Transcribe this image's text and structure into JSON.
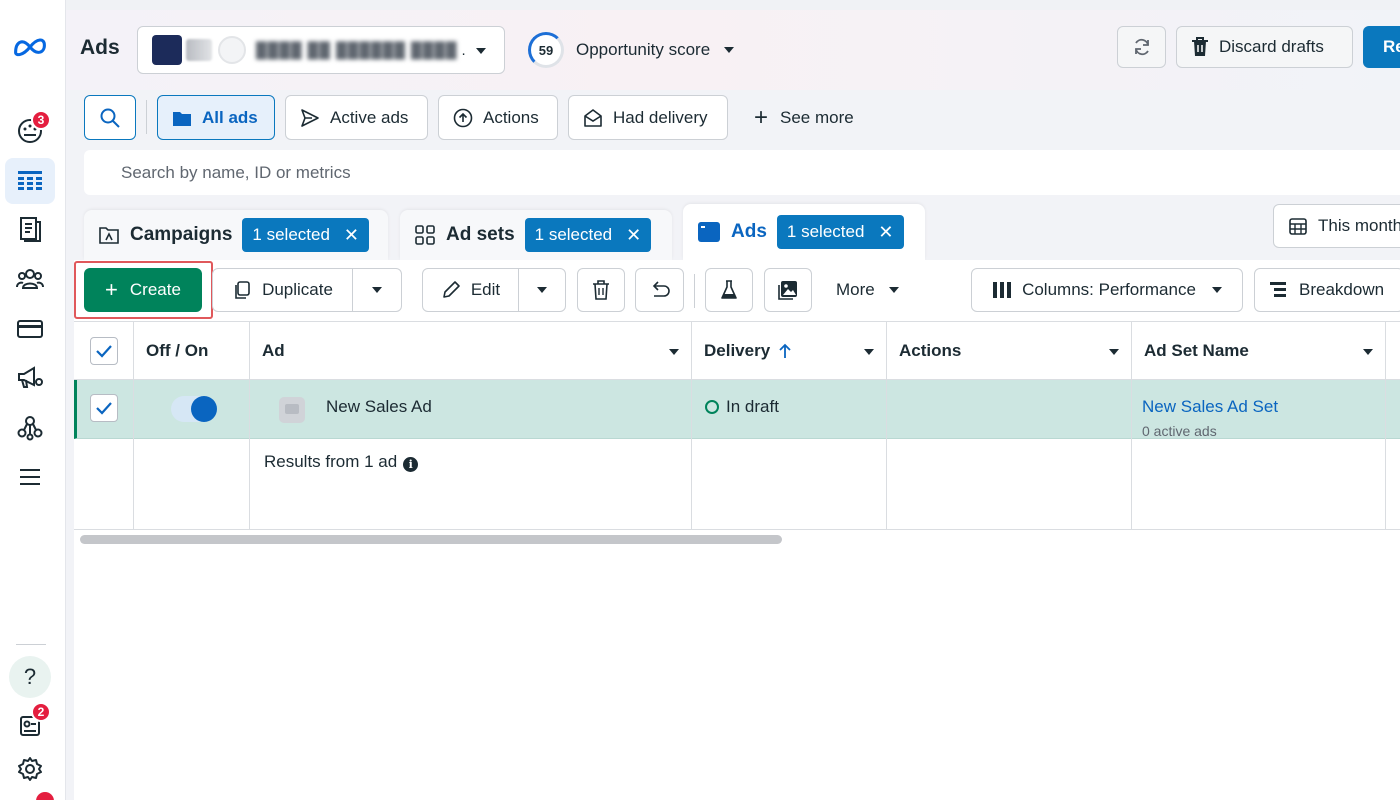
{
  "app": {
    "title": "Ads"
  },
  "account": {
    "name_obscured": "████ ██ ██████ ████",
    "trailing_dot": "."
  },
  "opportunity": {
    "score": "59",
    "label": "Opportunity score"
  },
  "header_actions": {
    "discard_label": "Discard drafts",
    "review_label": "Re"
  },
  "rail": {
    "items": [
      {
        "name": "performance",
        "badge": "3"
      },
      {
        "name": "campaigns-table",
        "active": true
      },
      {
        "name": "reports"
      },
      {
        "name": "audiences"
      },
      {
        "name": "billing"
      },
      {
        "name": "advertising"
      },
      {
        "name": "business-suite"
      },
      {
        "name": "all-tools"
      }
    ],
    "help_label": "?",
    "notifications_badge": "2"
  },
  "filters": {
    "chips": [
      {
        "label": "All ads",
        "icon": "folder-icon",
        "active": true
      },
      {
        "label": "Active ads",
        "icon": "send-icon"
      },
      {
        "label": "Actions",
        "icon": "upload-circle-icon"
      },
      {
        "label": "Had delivery",
        "icon": "envelope-icon"
      }
    ],
    "see_more_label": "See more",
    "search_placeholder": "Search by name, ID or metrics"
  },
  "levels": {
    "campaigns": {
      "label": "Campaigns",
      "selected": "1 selected"
    },
    "adsets": {
      "label": "Ad sets",
      "selected": "1 selected"
    },
    "ads": {
      "label": "Ads",
      "selected": "1 selected",
      "active": true
    },
    "date_range": "This month"
  },
  "toolbar": {
    "create_label": "Create",
    "duplicate_label": "Duplicate",
    "edit_label": "Edit",
    "more_label": "More",
    "columns_label": "Columns: Performance",
    "breakdown_label": "Breakdown"
  },
  "table": {
    "headers": {
      "off_on": "Off / On",
      "ad": "Ad",
      "delivery": "Delivery",
      "actions": "Actions",
      "ad_set_name": "Ad Set Name"
    },
    "rows": [
      {
        "selected": true,
        "enabled": true,
        "ad_name": "New Sales Ad",
        "delivery": "In draft",
        "actions": "",
        "ad_set_name": "New Sales Ad Set",
        "ad_set_sub": "0 active ads"
      }
    ],
    "summary": {
      "results_label": "Results from 1 ad",
      "info": "i"
    }
  },
  "colors": {
    "primary_blue": "#0a78be",
    "create_green": "#00835b",
    "selected_row": "#cce6e1",
    "highlight_outline": "#e0585b",
    "badge_red": "#e41e3f"
  }
}
